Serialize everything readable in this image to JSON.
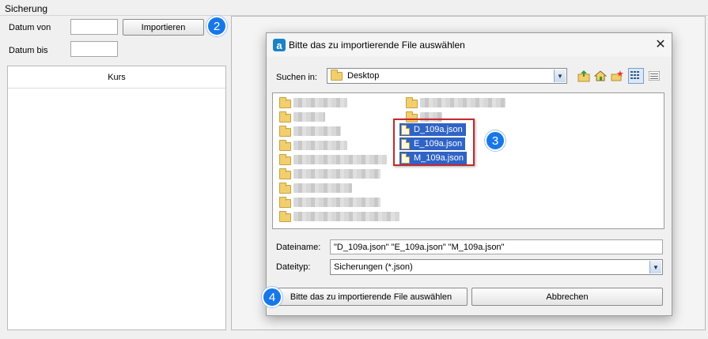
{
  "app": {
    "title": "Sicherung",
    "datum_von_label": "Datum von",
    "datum_bis_label": "Datum bis",
    "datum_von_value": "",
    "datum_bis_value": "",
    "import_button": "Importieren",
    "kurs_header": "Kurs"
  },
  "badges": {
    "b2": "2",
    "b3": "3",
    "b4": "4"
  },
  "dialog": {
    "title": "Bitte das zu importierende File auswählen",
    "look_in_label": "Suchen in:",
    "look_in_value": "Desktop",
    "files": [
      "D_109a.json",
      "E_109a.json",
      "M_109a.json"
    ],
    "filename_label": "Dateiname:",
    "filename_value": "\"D_109a.json\" \"E_109a.json\" \"M_109a.json\"",
    "filetype_label": "Dateityp:",
    "filetype_value": "Sicherungen (*.json)",
    "open_button": "Bitte das zu importierende File auswählen",
    "cancel_button": "Abbrechen"
  },
  "colors": {
    "badge": "#1877e7",
    "selection": "#2f63c5",
    "highlight_box": "#c8282c"
  }
}
